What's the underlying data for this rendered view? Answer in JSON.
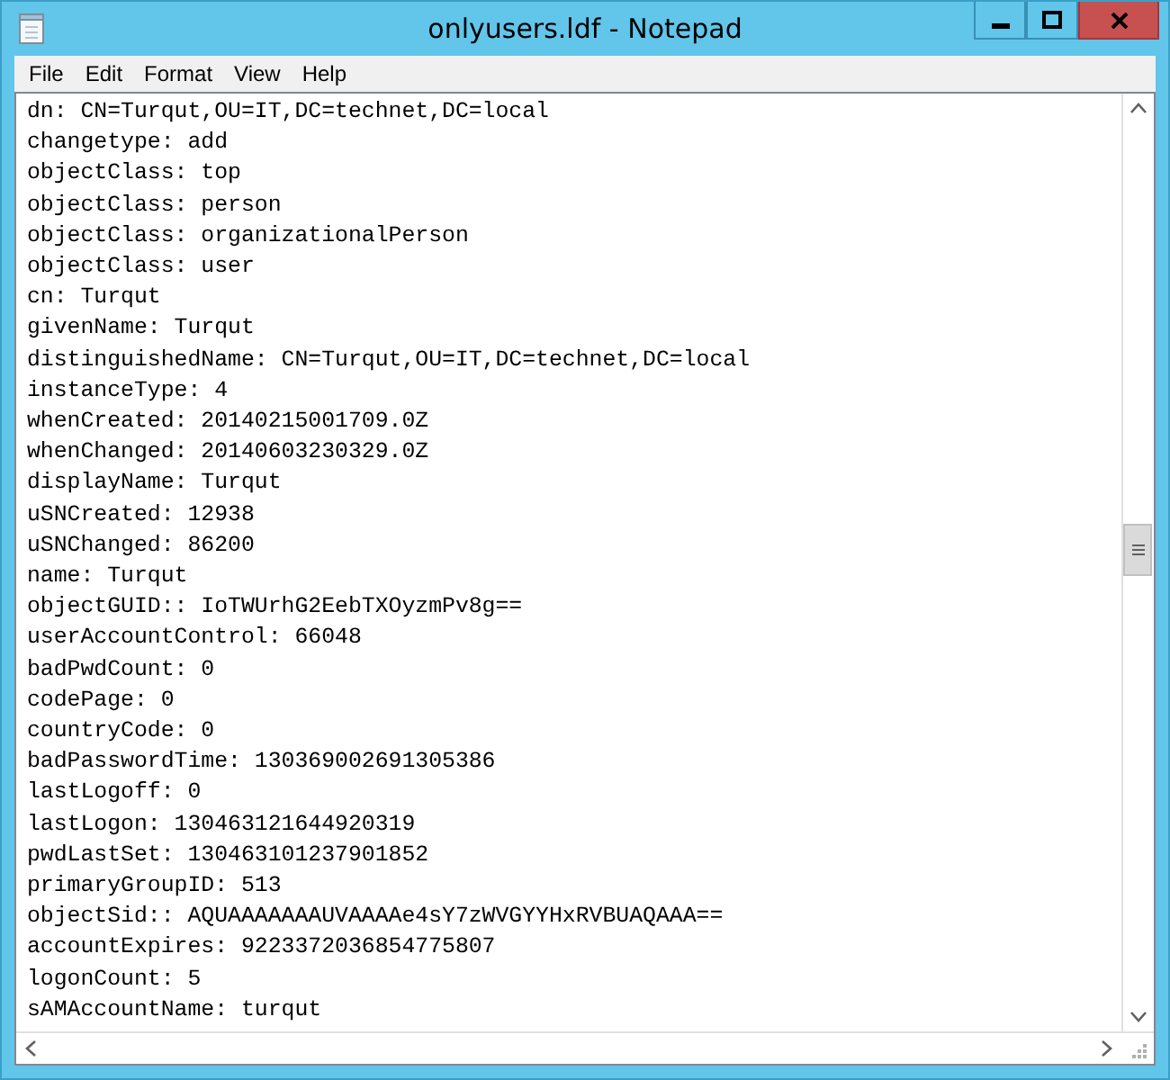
{
  "window": {
    "title": "onlyusers.ldf - Notepad"
  },
  "menu": [
    "File",
    "Edit",
    "Format",
    "View",
    "Help"
  ],
  "lines": [
    "dn: CN=Turqut,OU=IT,DC=technet,DC=local",
    "changetype: add",
    "objectClass: top",
    "objectClass: person",
    "objectClass: organizationalPerson",
    "objectClass: user",
    "cn: Turqut",
    "givenName: Turqut",
    "distinguishedName: CN=Turqut,OU=IT,DC=technet,DC=local",
    "instanceType: 4",
    "whenCreated: 20140215001709.0Z",
    "whenChanged: 20140603230329.0Z",
    "displayName: Turqut",
    "uSNCreated: 12938",
    "uSNChanged: 86200",
    "name: Turqut",
    "objectGUID:: IoTWUrhG2EebTXOyzmPv8g==",
    "userAccountControl: 66048",
    "badPwdCount: 0",
    "codePage: 0",
    "countryCode: 0",
    "badPasswordTime: 130369002691305386",
    "lastLogoff: 0",
    "lastLogon: 130463121644920319",
    "pwdLastSet: 130463101237901852",
    "primaryGroupID: 513",
    "objectSid:: AQUAAAAAAAUVAAAAe4sY7zWVGYYHxRVBUAQAAA==",
    "accountExpires: 9223372036854775807",
    "logonCount: 5",
    "sAMAccountName: turqut"
  ]
}
